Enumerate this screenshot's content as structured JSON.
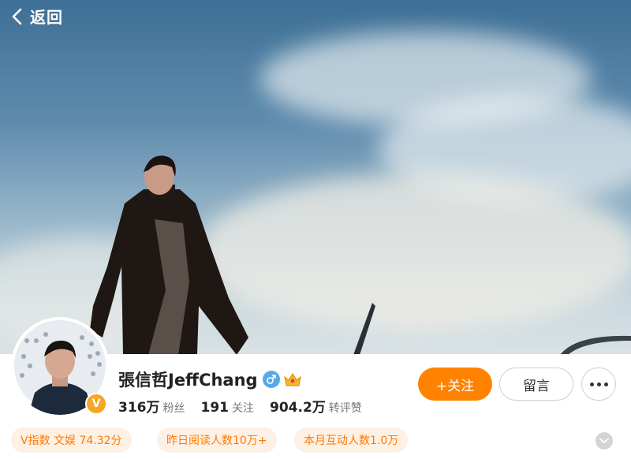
{
  "nav": {
    "back_label": "返回",
    "back_icon": "chevron-left-icon"
  },
  "profile": {
    "name": "張信哲JeffChang",
    "gender_icon": "male-icon",
    "member_icon": "crown-icon",
    "verified_badge": "V",
    "stats": [
      {
        "value": "316万",
        "label": "粉丝"
      },
      {
        "value": "191",
        "label": "关注"
      },
      {
        "value": "904.2万",
        "label": "转评赞"
      }
    ]
  },
  "actions": {
    "follow_label": "+关注",
    "message_label": "留言",
    "more_icon": "more-dots-icon"
  },
  "tags": [
    {
      "text": "V指数 文娱 74.32分"
    },
    {
      "text": "昨日阅读人数10万+"
    },
    {
      "text": "本月互动人数1.0万"
    }
  ],
  "colors": {
    "accent": "#ff8200",
    "tag_bg": "#fdf1e6",
    "tag_text": "#ff7a00",
    "gender_blue": "#57a9e6"
  }
}
